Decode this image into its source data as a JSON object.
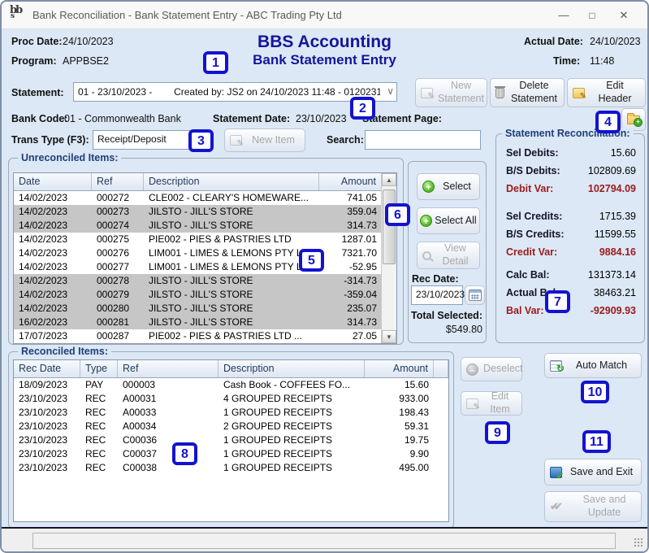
{
  "window": {
    "title": "Bank Reconciliation - Bank Statement Entry - ABC Trading Pty Ltd"
  },
  "header": {
    "proc_date_label": "Proc Date:",
    "proc_date": "24/10/2023",
    "program_label": "Program:",
    "program": "APPBSE2",
    "app_title": "BBS Accounting",
    "screen_title": "Bank Statement Entry",
    "actual_date_label": "Actual Date:",
    "actual_date": "24/10/2023",
    "time_label": "Time:",
    "time": "11:48"
  },
  "statement_row": {
    "label": "Statement:",
    "value": "01 - 23/10/2023 -        Created by: JS2 on 24/10/2023 11:48 - 0120231",
    "new_button": "New\nStatement",
    "delete_button": "Delete\nStatement",
    "edit_button": "Edit\nHeader"
  },
  "bank_row": {
    "bank_code_label": "Bank Code:",
    "bank_code": "01 - Commonwealth Bank",
    "statement_date_label": "Statement Date:",
    "statement_date": "23/10/2023",
    "statement_page_label": "Statement Page:",
    "statement_page": ""
  },
  "trans_row": {
    "trans_type_label": "Trans Type (F3):",
    "trans_type": "Receipt/Deposit",
    "new_item_button": "New Item",
    "search_label": "Search:",
    "search_value": ""
  },
  "unreconciled": {
    "legend": "Unreconciled Items:",
    "columns": [
      "Date",
      "Ref",
      "Description",
      "Amount"
    ],
    "rows": [
      {
        "date": "14/02/2023",
        "ref": "000272",
        "description": "CLE002 - CLEARY'S HOMEWARE...",
        "amount": "741.05",
        "selected": false
      },
      {
        "date": "14/02/2023",
        "ref": "000273",
        "description": "JILSTO - JILL'S STORE",
        "amount": "359.04",
        "selected": true
      },
      {
        "date": "14/02/2023",
        "ref": "000274",
        "description": "JILSTO - JILL'S STORE",
        "amount": "314.73",
        "selected": true
      },
      {
        "date": "14/02/2023",
        "ref": "000275",
        "description": "PIE002 - PIES & PASTRIES LTD",
        "amount": "1287.01",
        "selected": false
      },
      {
        "date": "14/02/2023",
        "ref": "000276",
        "description": "LIM001 - LIMES & LEMONS PTY L...",
        "amount": "7321.70",
        "selected": false
      },
      {
        "date": "14/02/2023",
        "ref": "000277",
        "description": "LIM001 - LIMES & LEMONS PTY L...",
        "amount": "-52.95",
        "selected": false
      },
      {
        "date": "14/02/2023",
        "ref": "000278",
        "description": "JILSTO - JILL'S STORE",
        "amount": "-314.73",
        "selected": true
      },
      {
        "date": "14/02/2023",
        "ref": "000279",
        "description": "JILSTO - JILL'S STORE",
        "amount": "-359.04",
        "selected": true
      },
      {
        "date": "14/02/2023",
        "ref": "000280",
        "description": "JILSTO - JILL'S STORE",
        "amount": "235.07",
        "selected": true
      },
      {
        "date": "16/02/2023",
        "ref": "000281",
        "description": "JILSTO - JILL'S STORE",
        "amount": "314.73",
        "selected": true
      },
      {
        "date": "17/07/2023",
        "ref": "000287",
        "description": "PIE002 - PIES & PASTRIES LTD ...",
        "amount": "27.05",
        "selected": false
      }
    ]
  },
  "middle_panel": {
    "select_button": "Select",
    "select_all_button": "Select All",
    "view_detail_button": "View\nDetail",
    "rec_date_label": "Rec Date:",
    "rec_date": "23/10/2023",
    "total_selected_label": "Total Selected:",
    "total_selected": "$549.80"
  },
  "reconciliation": {
    "legend": "Statement Reconciliation:",
    "rows": [
      {
        "label": "Sel Debits:",
        "value": "15.60",
        "variance": false
      },
      {
        "label": "B/S Debits:",
        "value": "102809.69",
        "variance": false
      },
      {
        "label": "Debit Var:",
        "value": "102794.09",
        "variance": true
      },
      {
        "label": "Sel Credits:",
        "value": "1715.39",
        "variance": false
      },
      {
        "label": "B/S Credits:",
        "value": "11599.55",
        "variance": false
      },
      {
        "label": "Credit Var:",
        "value": "9884.16",
        "variance": true
      },
      {
        "label": "Calc Bal:",
        "value": "131373.14",
        "variance": false
      },
      {
        "label": "Actual Bal:",
        "value": "38463.21",
        "variance": false
      },
      {
        "label": "Bal Var:",
        "value": "-92909.93",
        "variance": true
      }
    ]
  },
  "reconciled": {
    "legend": "Reconciled Items:",
    "columns": [
      "Rec Date",
      "Type",
      "Ref",
      "Description",
      "Amount"
    ],
    "rows": [
      {
        "rec_date": "18/09/2023",
        "type": "PAY",
        "ref": "000003",
        "description": "Cash Book - COFFEES FO...",
        "amount": "15.60"
      },
      {
        "rec_date": "23/10/2023",
        "type": "REC",
        "ref": "A00031",
        "description": "4 GROUPED RECEIPTS",
        "amount": "933.00"
      },
      {
        "rec_date": "23/10/2023",
        "type": "REC",
        "ref": "A00033",
        "description": "1 GROUPED RECEIPTS",
        "amount": "198.43"
      },
      {
        "rec_date": "23/10/2023",
        "type": "REC",
        "ref": "A00034",
        "description": "2 GROUPED RECEIPTS",
        "amount": "59.31"
      },
      {
        "rec_date": "23/10/2023",
        "type": "REC",
        "ref": "C00036",
        "description": "1 GROUPED RECEIPTS",
        "amount": "19.75"
      },
      {
        "rec_date": "23/10/2023",
        "type": "REC",
        "ref": "C00037",
        "description": "1 GROUPED RECEIPTS",
        "amount": "9.90"
      },
      {
        "rec_date": "23/10/2023",
        "type": "REC",
        "ref": "C00038",
        "description": "1 GROUPED RECEIPTS",
        "amount": "495.00"
      }
    ]
  },
  "actions": {
    "deselect_button": "Deselect",
    "edit_item_button": "Edit Item",
    "auto_match_button": "Auto Match",
    "save_exit_button": "Save and Exit",
    "save_update_button": "Save and\nUpdate"
  },
  "callouts": [
    "1",
    "2",
    "3",
    "4",
    "5",
    "6",
    "7",
    "8",
    "9",
    "10",
    "11"
  ],
  "icons": {
    "app_logo": "bbs-logo",
    "new_statement": "form-pencil",
    "delete_statement": "trash",
    "edit_header": "yellow-note-pencil",
    "add_statement_page": "folder-plus",
    "new_item": "form-pencil",
    "select": "green-plus-circle",
    "select_all": "green-plus-circle",
    "view_detail": "magnifier",
    "rec_date_picker": "calendar",
    "deselect": "gray-minus-circle",
    "edit_item": "form-pencil",
    "auto_match": "grid-refresh",
    "save_exit": "disk-check",
    "save_update": "double-check"
  },
  "colors": {
    "heading_navy": "#15159b",
    "variance_red": "#9b1b1b",
    "selected_row_gray": "#c6c6c6",
    "callout_blue": "#1313cf",
    "window_background": "#dce8f5"
  }
}
